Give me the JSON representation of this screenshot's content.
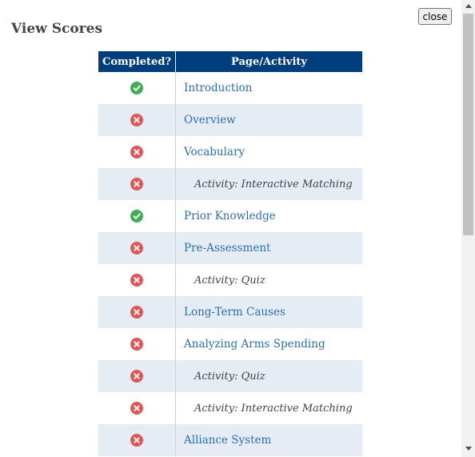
{
  "dialog": {
    "title": "View Scores",
    "close_label": "close"
  },
  "colors": {
    "header_bg": "#003e7e",
    "row_alt_bg": "#e5ecf4",
    "link": "#2a6fb5",
    "complete": "#3cb054",
    "incomplete": "#e05757"
  },
  "table": {
    "headers": {
      "completed": "Completed?",
      "page": "Page/Activity"
    },
    "rows": [
      {
        "status": "complete",
        "label": "Introduction",
        "kind": "page"
      },
      {
        "status": "incomplete",
        "label": "Overview",
        "kind": "page"
      },
      {
        "status": "incomplete",
        "label": "Vocabulary",
        "kind": "page"
      },
      {
        "status": "incomplete",
        "label": "Activity: Interactive Matching",
        "kind": "activity"
      },
      {
        "status": "complete",
        "label": "Prior Knowledge",
        "kind": "page"
      },
      {
        "status": "incomplete",
        "label": "Pre-Assessment",
        "kind": "page"
      },
      {
        "status": "incomplete",
        "label": "Activity: Quiz",
        "kind": "activity"
      },
      {
        "status": "incomplete",
        "label": "Long-Term Causes",
        "kind": "page"
      },
      {
        "status": "incomplete",
        "label": "Analyzing Arms Spending",
        "kind": "page"
      },
      {
        "status": "incomplete",
        "label": "Activity: Quiz",
        "kind": "activity"
      },
      {
        "status": "incomplete",
        "label": "Activity: Interactive Matching",
        "kind": "activity"
      },
      {
        "status": "incomplete",
        "label": "Alliance System",
        "kind": "page"
      }
    ]
  }
}
